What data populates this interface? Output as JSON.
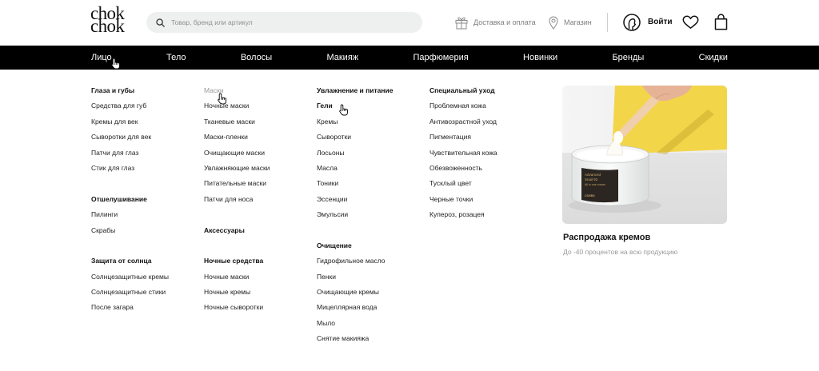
{
  "logo": {
    "line1": "chok",
    "line2": "chok"
  },
  "search": {
    "placeholder": "Товар, бренд или артикул",
    "value": ""
  },
  "header": {
    "delivery_label": "Доставка и оплата",
    "store_label": "Магазин",
    "login_label": "Войти"
  },
  "nav": [
    "Лицо",
    "Тело",
    "Волосы",
    "Макияж",
    "Парфюмерия",
    "Новинки",
    "Бренды",
    "Скидки"
  ],
  "menu": {
    "columns": [
      {
        "groups": [
          {
            "heading": "Глаза и губы",
            "items": [
              "Средства для губ",
              "Кремы для век",
              "Сыворотки для век",
              "Патчи для глаз",
              "Стик для глаз"
            ]
          },
          {
            "heading": "Отшелушивание",
            "items": [
              "Пилинги",
              "Скрабы"
            ]
          },
          {
            "heading": "Защита от солнца",
            "items": [
              "Солнцезащитные кремы",
              "Солнцезащитные стики",
              "После загара"
            ]
          }
        ]
      },
      {
        "groups": [
          {
            "heading": "Маски",
            "items": [
              "Ночные маски",
              "Тканевые маски",
              "Маски-пленки",
              "Очищающие маски",
              "Увлажняющие маски",
              "Питательные маски",
              "Патчи для носа"
            ]
          },
          {
            "heading": "Аксессуары",
            "items": []
          },
          {
            "heading": "Ночные средства",
            "items": [
              "Ночные маски",
              "Ночные кремы",
              "Ночные сыворотки"
            ]
          }
        ]
      },
      {
        "groups": [
          {
            "heading": "Увлажнение и питание",
            "items": [
              "Гели",
              "Кремы",
              "Сыворотки",
              "Лосьоны",
              "Масла",
              "Тоники",
              "Эссенции",
              "Эмульсии"
            ]
          },
          {
            "heading": "Очищение",
            "items": [
              "Гидрофильное масло",
              "Пенки",
              "Очищающие кремы",
              "Мицеллярная вода",
              "Мыло",
              "Снятие макияжа"
            ]
          }
        ]
      },
      {
        "groups": [
          {
            "heading": "Специальный уход",
            "items": [
              "Проблемная кожа",
              "Антивозрастной уход",
              "Пигментация",
              "Чувствительная кожа",
              "Обезвоженность",
              "Тусклый цвет",
              "Черные точки",
              "Купероз, розацея"
            ]
          }
        ]
      }
    ]
  },
  "promo": {
    "title": "Распродажа кремов",
    "subtitle": "До -40 процентов на всю продукцию",
    "product_label": {
      "line1": "Advanced",
      "line2": "Snail 92",
      "line3": "All in one cream",
      "brand": "COSRX"
    }
  },
  "icons": {
    "search": "search-icon",
    "delivery": "gift-box-icon",
    "store": "location-pin-icon",
    "account": "user-icon",
    "favorites": "heart-icon",
    "cart": "shopping-bag-icon",
    "cursor": "hand-cursor-icon"
  },
  "colors": {
    "nav_background": "#000000",
    "nav_text": "#ffffff",
    "text": "#1a1a1a",
    "muted_text": "#9a9a9a",
    "search_background": "#eef0ef",
    "promo_yellow": "#f3d54a"
  }
}
